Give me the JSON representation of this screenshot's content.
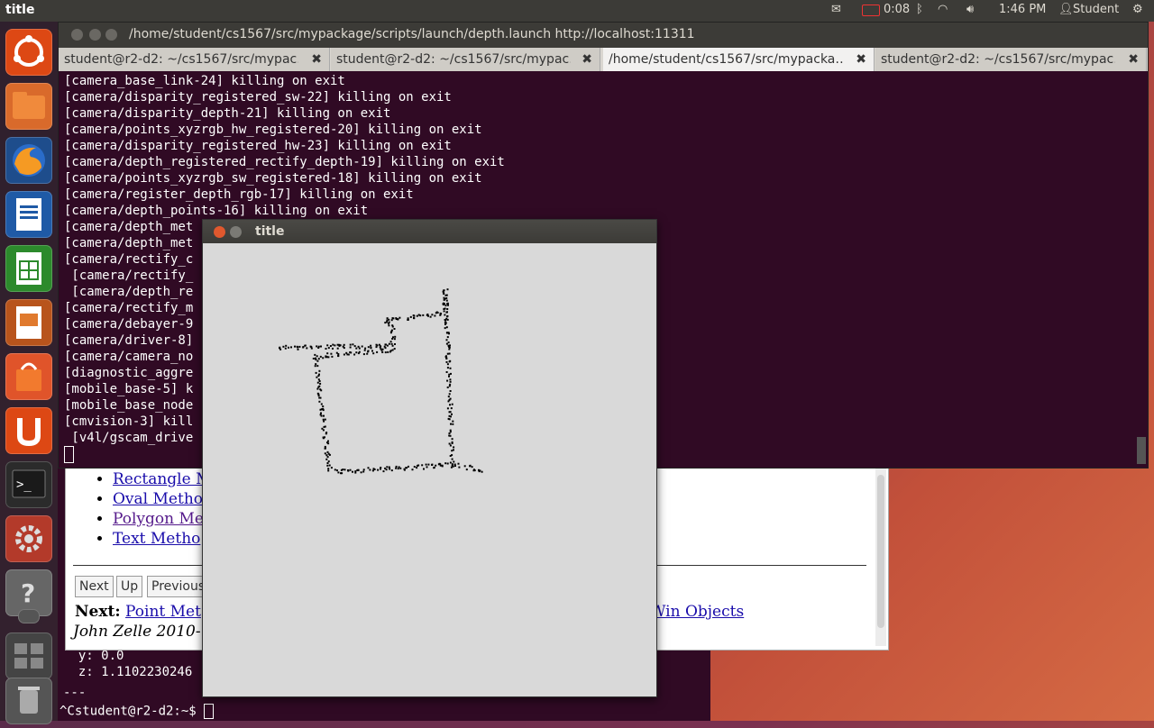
{
  "top_panel": {
    "app_title": "title",
    "battery_time": "0:08",
    "clock": "1:46 PM",
    "user": "Student"
  },
  "main_terminal": {
    "window_title": "/home/student/cs1567/src/mypackage/scripts/launch/depth.launch http://localhost:11311",
    "tabs": [
      {
        "label": "student@r2-d2: ~/cs1567/src/mypac…",
        "close": "✖",
        "active": false
      },
      {
        "label": "student@r2-d2: ~/cs1567/src/mypac…",
        "close": "✖",
        "active": false
      },
      {
        "label": "/home/student/cs1567/src/mypacka…",
        "close": "✖",
        "active": true
      },
      {
        "label": "student@r2-d2: ~/cs1567/src/mypac…",
        "close": "✖",
        "active": false
      }
    ],
    "output_lines": [
      "[camera_base_link-24] killing on exit",
      "[camera/disparity_registered_sw-22] killing on exit",
      "[camera/disparity_depth-21] killing on exit",
      "[camera/points_xyzrgb_hw_registered-20] killing on exit",
      "[camera/disparity_registered_hw-23] killing on exit",
      "[camera/depth_registered_rectify_depth-19] killing on exit",
      "[camera/points_xyzrgb_sw_registered-18] killing on exit",
      "[camera/register_depth_rgb-17] killing on exit",
      "[camera/depth_points-16] killing on exit",
      "[camera/depth_met",
      "[camera/depth_met",
      "[camera/rectify_c",
      " [camera/rectify_",
      " [camera/depth_re",
      "[camera/rectify_m",
      "[camera/debayer-9",
      "[camera/driver-8]",
      "[camera/camera_no",
      "[diagnostic_aggre",
      "[mobile_base-5] k",
      "[mobile_base_node",
      "[cmvision-3] kill",
      " [v4l/gscam_drive"
    ]
  },
  "browser": {
    "links": [
      "Rectangle M",
      "Oval Metho",
      "Polygon Me",
      "Text Metho"
    ],
    "buttons": [
      "Next",
      "Up",
      "Previous"
    ],
    "next_label": "Next:",
    "next_link": "Point Met",
    "win_objects_link": "Win Objects",
    "author": "John Zelle 2010-"
  },
  "bg_terminal": {
    "lines": [
      "  y: 0.0",
      "  z: 1.1102230246",
      "---"
    ],
    "prompt": "^Cstudent@r2-d2:~$ "
  },
  "graphics_window": {
    "title": "title"
  }
}
